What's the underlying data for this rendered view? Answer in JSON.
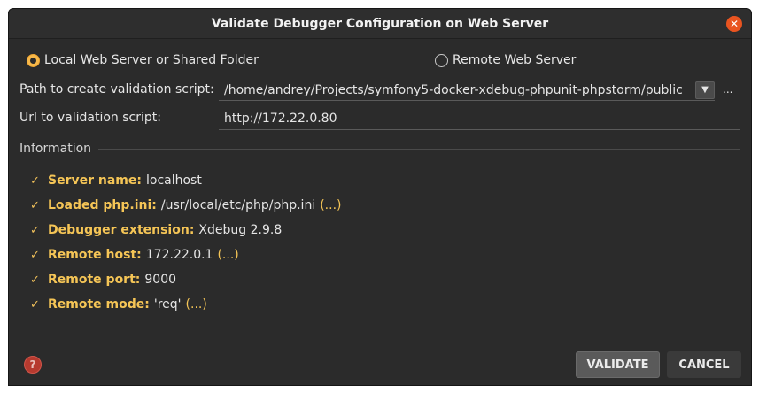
{
  "dialog": {
    "title": "Validate Debugger Configuration on Web Server",
    "close_icon": "close-icon"
  },
  "options": {
    "local": {
      "label": "Local Web Server or Shared Folder",
      "selected": true
    },
    "remote": {
      "label": "Remote Web Server",
      "selected": false
    }
  },
  "path": {
    "label": "Path to create validation script:",
    "value": "/home/andrey/Projects/symfony5-docker-xdebug-phpunit-phpstorm/public",
    "browse_label": "..."
  },
  "url": {
    "label": "Url to validation script:",
    "value": "http://172.22.0.80"
  },
  "information": {
    "title": "Information",
    "items": [
      {
        "key": "Server name:",
        "value": "localhost",
        "more": ""
      },
      {
        "key": "Loaded php.ini:",
        "value": "/usr/local/etc/php/php.ini",
        "more": "(...)"
      },
      {
        "key": "Debugger extension:",
        "value": "Xdebug 2.9.8",
        "more": ""
      },
      {
        "key": "Remote host:",
        "value": "172.22.0.1",
        "more": "(...)"
      },
      {
        "key": "Remote port:",
        "value": "9000",
        "more": ""
      },
      {
        "key": "Remote mode:",
        "value": "'req'",
        "more": "(...)"
      }
    ]
  },
  "buttons": {
    "validate": "VALIDATE",
    "cancel": "CANCEL"
  },
  "colors": {
    "background": "#2b2b2b",
    "accent": "#f5c556",
    "close": "#e95420",
    "help": "#b63a2f"
  }
}
